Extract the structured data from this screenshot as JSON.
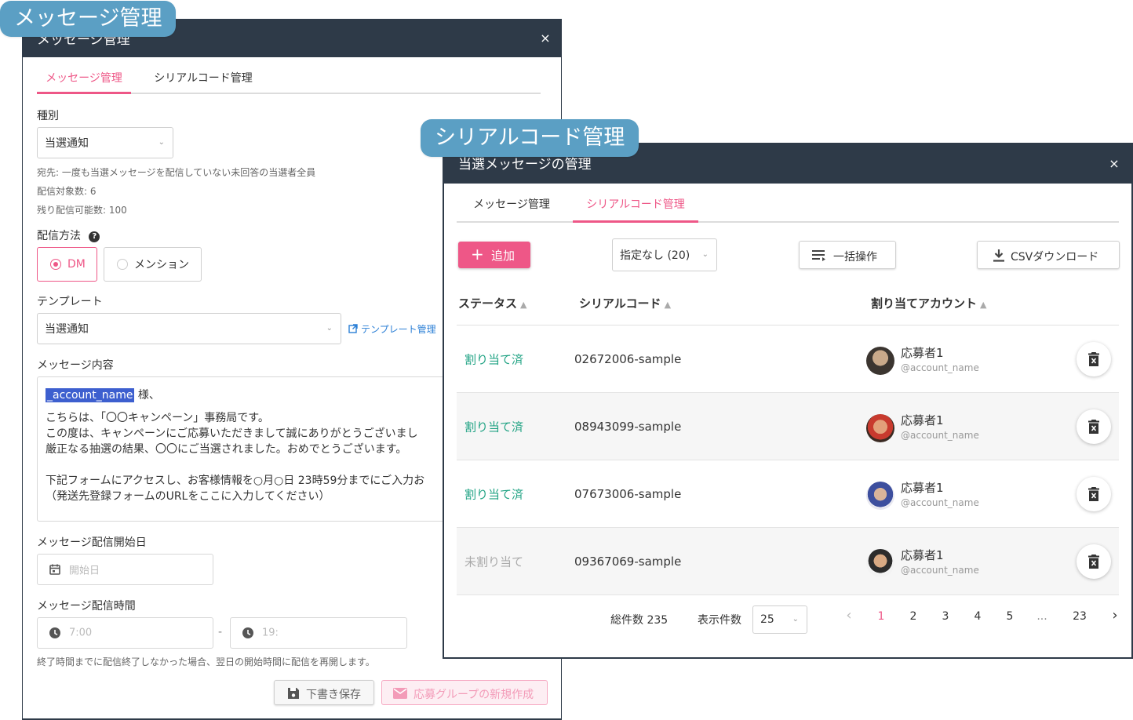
{
  "callouts": {
    "message": "メッセージ管理",
    "serial": "シリアルコード管理"
  },
  "colors": {
    "accent": "#ee5787",
    "header": "#2e3a48",
    "assigned": "#21a384",
    "link": "#2b7fd6",
    "badge": "#5b9fc4"
  },
  "message_window": {
    "title": "メッセージ管理",
    "close_icon": "×",
    "tabs": [
      {
        "label": "メッセージ管理",
        "active": true
      },
      {
        "label": "シリアルコード管理",
        "active": false
      }
    ],
    "type_label": "種別",
    "type_value": "当選通知",
    "recipient_note": "宛先: 一度も当選メッセージを配信していない未回答の当選者全員",
    "target_count": "配信対象数: 6",
    "remaining_count": "残り配信可能数: 100",
    "method_label": "配信方法",
    "method_options": [
      {
        "label": "DM",
        "selected": true
      },
      {
        "label": "メンション",
        "selected": false
      }
    ],
    "template_label": "テンプレート",
    "template_value": "当選通知",
    "template_link": "テンプレート管理",
    "content_label": "メッセージ内容",
    "content": {
      "token": "_account_name",
      "line1_suffix": " 様、",
      "line2": "こちらは、「〇〇キャンペーン」事務局です。",
      "line3": "この度は、キャンペーンにご応募いただきまして誠にありがとうございまし",
      "line4": "厳正なる抽選の結果、〇〇にご当選されました。おめでとうございます。",
      "line5": "下記フォームにアクセスし、お客様情報を○月○日 23時59分までにご入力お",
      "line6": "（発送先登録フォームのURLをここに入力してください）"
    },
    "start_date_label": "メッセージ配信開始日",
    "start_date_placeholder": "開始日",
    "time_label": "メッセージ配信時間",
    "time_start": "7:00",
    "time_separator": "-",
    "time_end": "19:",
    "time_note": "終了時間までに配信終了しなかった場合、翌日の開始時間に配信を再開します。",
    "draft_button": "下書き保存",
    "create_button": "応募グループの新規作成"
  },
  "serial_window": {
    "title": "当選メッセージの管理",
    "close_icon": "×",
    "tabs": [
      {
        "label": "メッセージ管理",
        "active": false
      },
      {
        "label": "シリアルコード管理",
        "active": true
      }
    ],
    "add_button": "追加",
    "filter_value": "指定なし (20)",
    "bulk_button": "一括操作",
    "csv_button": "CSVダウンロード",
    "columns": [
      "ステータス",
      "シリアルコード",
      "割り当てアカウント"
    ],
    "rows": [
      {
        "status": "割り当て済",
        "assigned": true,
        "code": "02672006-sample",
        "name": "応募者1",
        "account": "@account_name"
      },
      {
        "status": "割り当て済",
        "assigned": true,
        "code": "08943099-sample",
        "name": "応募者1",
        "account": "@account_name"
      },
      {
        "status": "割り当て済",
        "assigned": true,
        "code": "07673006-sample",
        "name": "応募者1",
        "account": "@account_name"
      },
      {
        "status": "未割り当て",
        "assigned": false,
        "code": "09367069-sample",
        "name": "応募者1",
        "account": "@account_name"
      }
    ],
    "footer": {
      "total": "総件数 235",
      "per_page_label": "表示件数",
      "per_page_value": "25",
      "pages": [
        "1",
        "2",
        "3",
        "4",
        "5",
        "...",
        "23"
      ],
      "current_page": "1",
      "prev_icon": "‹",
      "next_icon": "›"
    }
  }
}
